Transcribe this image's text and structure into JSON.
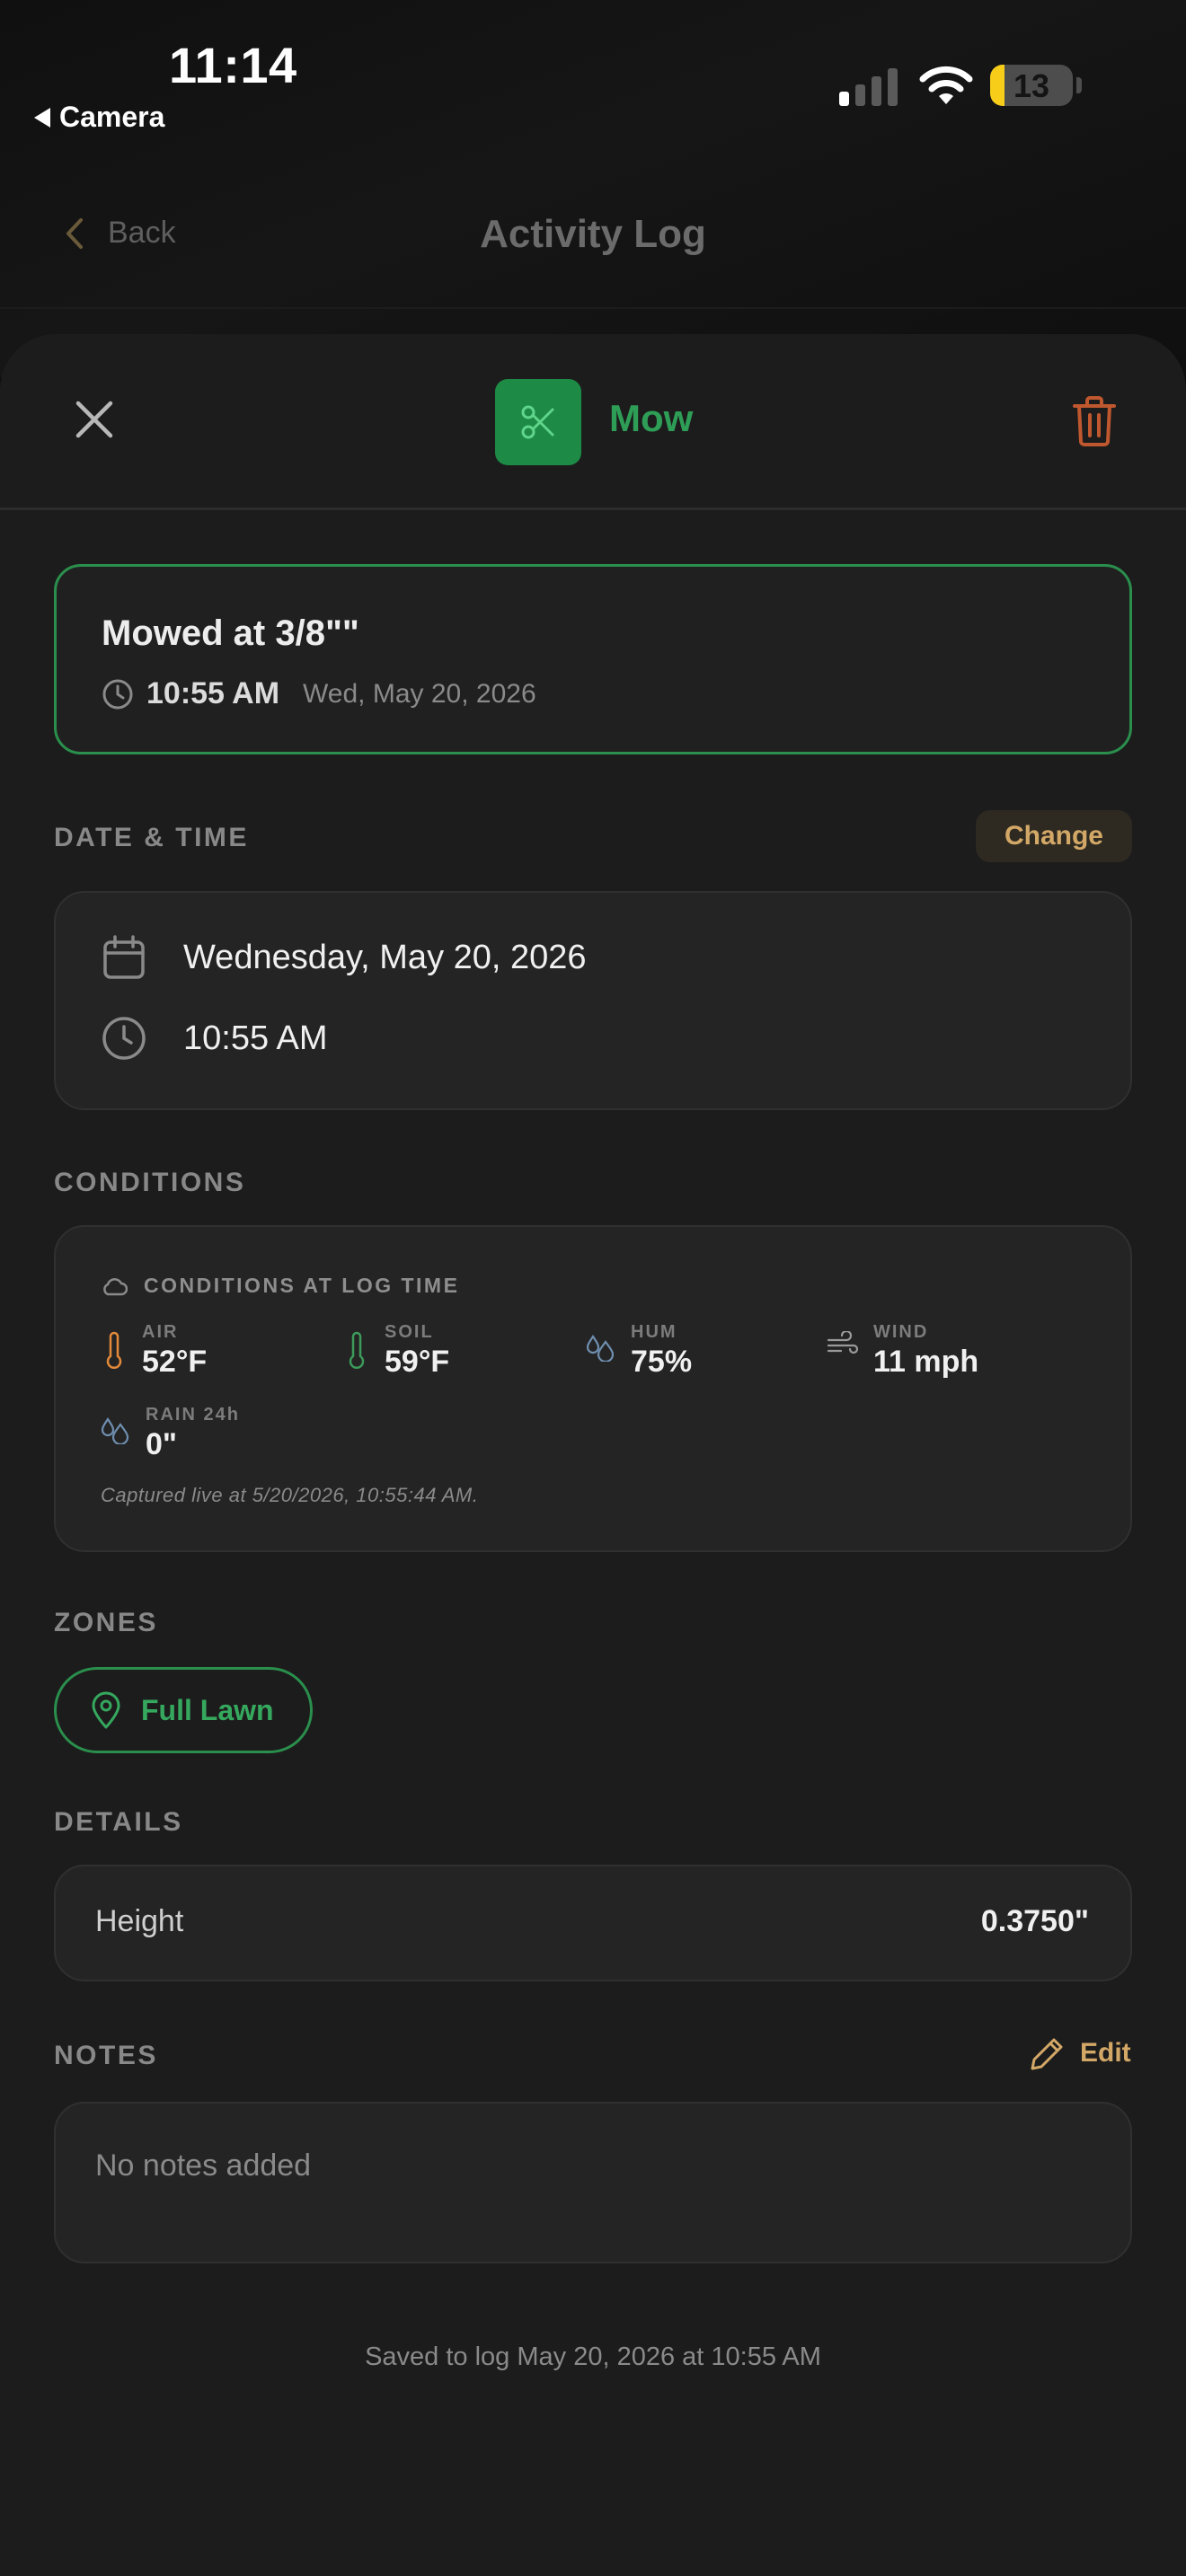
{
  "status_bar": {
    "time": "11:14",
    "back_app": "Camera",
    "battery_level": "13"
  },
  "nav": {
    "back_label": "Back",
    "title": "Activity Log"
  },
  "sheet": {
    "activity_name": "Mow",
    "activity_icon": "scissors-icon",
    "accent_color": "#2e9e57",
    "delete_color": "#c0582f"
  },
  "summary": {
    "title": "Mowed at 3/8\"\"",
    "time": "10:55 AM",
    "date": "Wed, May 20, 2026"
  },
  "date_time": {
    "label": "DATE & TIME",
    "change_label": "Change",
    "date": "Wednesday, May 20, 2026",
    "time": "10:55 AM"
  },
  "conditions": {
    "label": "CONDITIONS",
    "header": "CONDITIONS AT LOG TIME",
    "metrics": [
      {
        "label": "AIR",
        "value": "52°F",
        "icon": "thermometer-icon"
      },
      {
        "label": "SOIL",
        "value": "59°F",
        "icon": "thermometer-icon"
      },
      {
        "label": "HUM",
        "value": "75%",
        "icon": "droplets-icon"
      },
      {
        "label": "WIND",
        "value": "11 mph",
        "icon": "wind-icon"
      },
      {
        "label": "RAIN 24h",
        "value": "0\"",
        "icon": "droplets-icon"
      }
    ],
    "captured": "Captured live at 5/20/2026, 10:55:44 AM."
  },
  "zones": {
    "label": "ZONES",
    "items": [
      "Full Lawn"
    ]
  },
  "details": {
    "label": "DETAILS",
    "rows": [
      {
        "key": "Height",
        "value": "0.3750\""
      }
    ]
  },
  "notes": {
    "label": "NOTES",
    "edit_label": "Edit",
    "placeholder": "No notes added"
  },
  "footer": {
    "saved": "Saved to log May 20, 2026 at 10:55 AM"
  }
}
